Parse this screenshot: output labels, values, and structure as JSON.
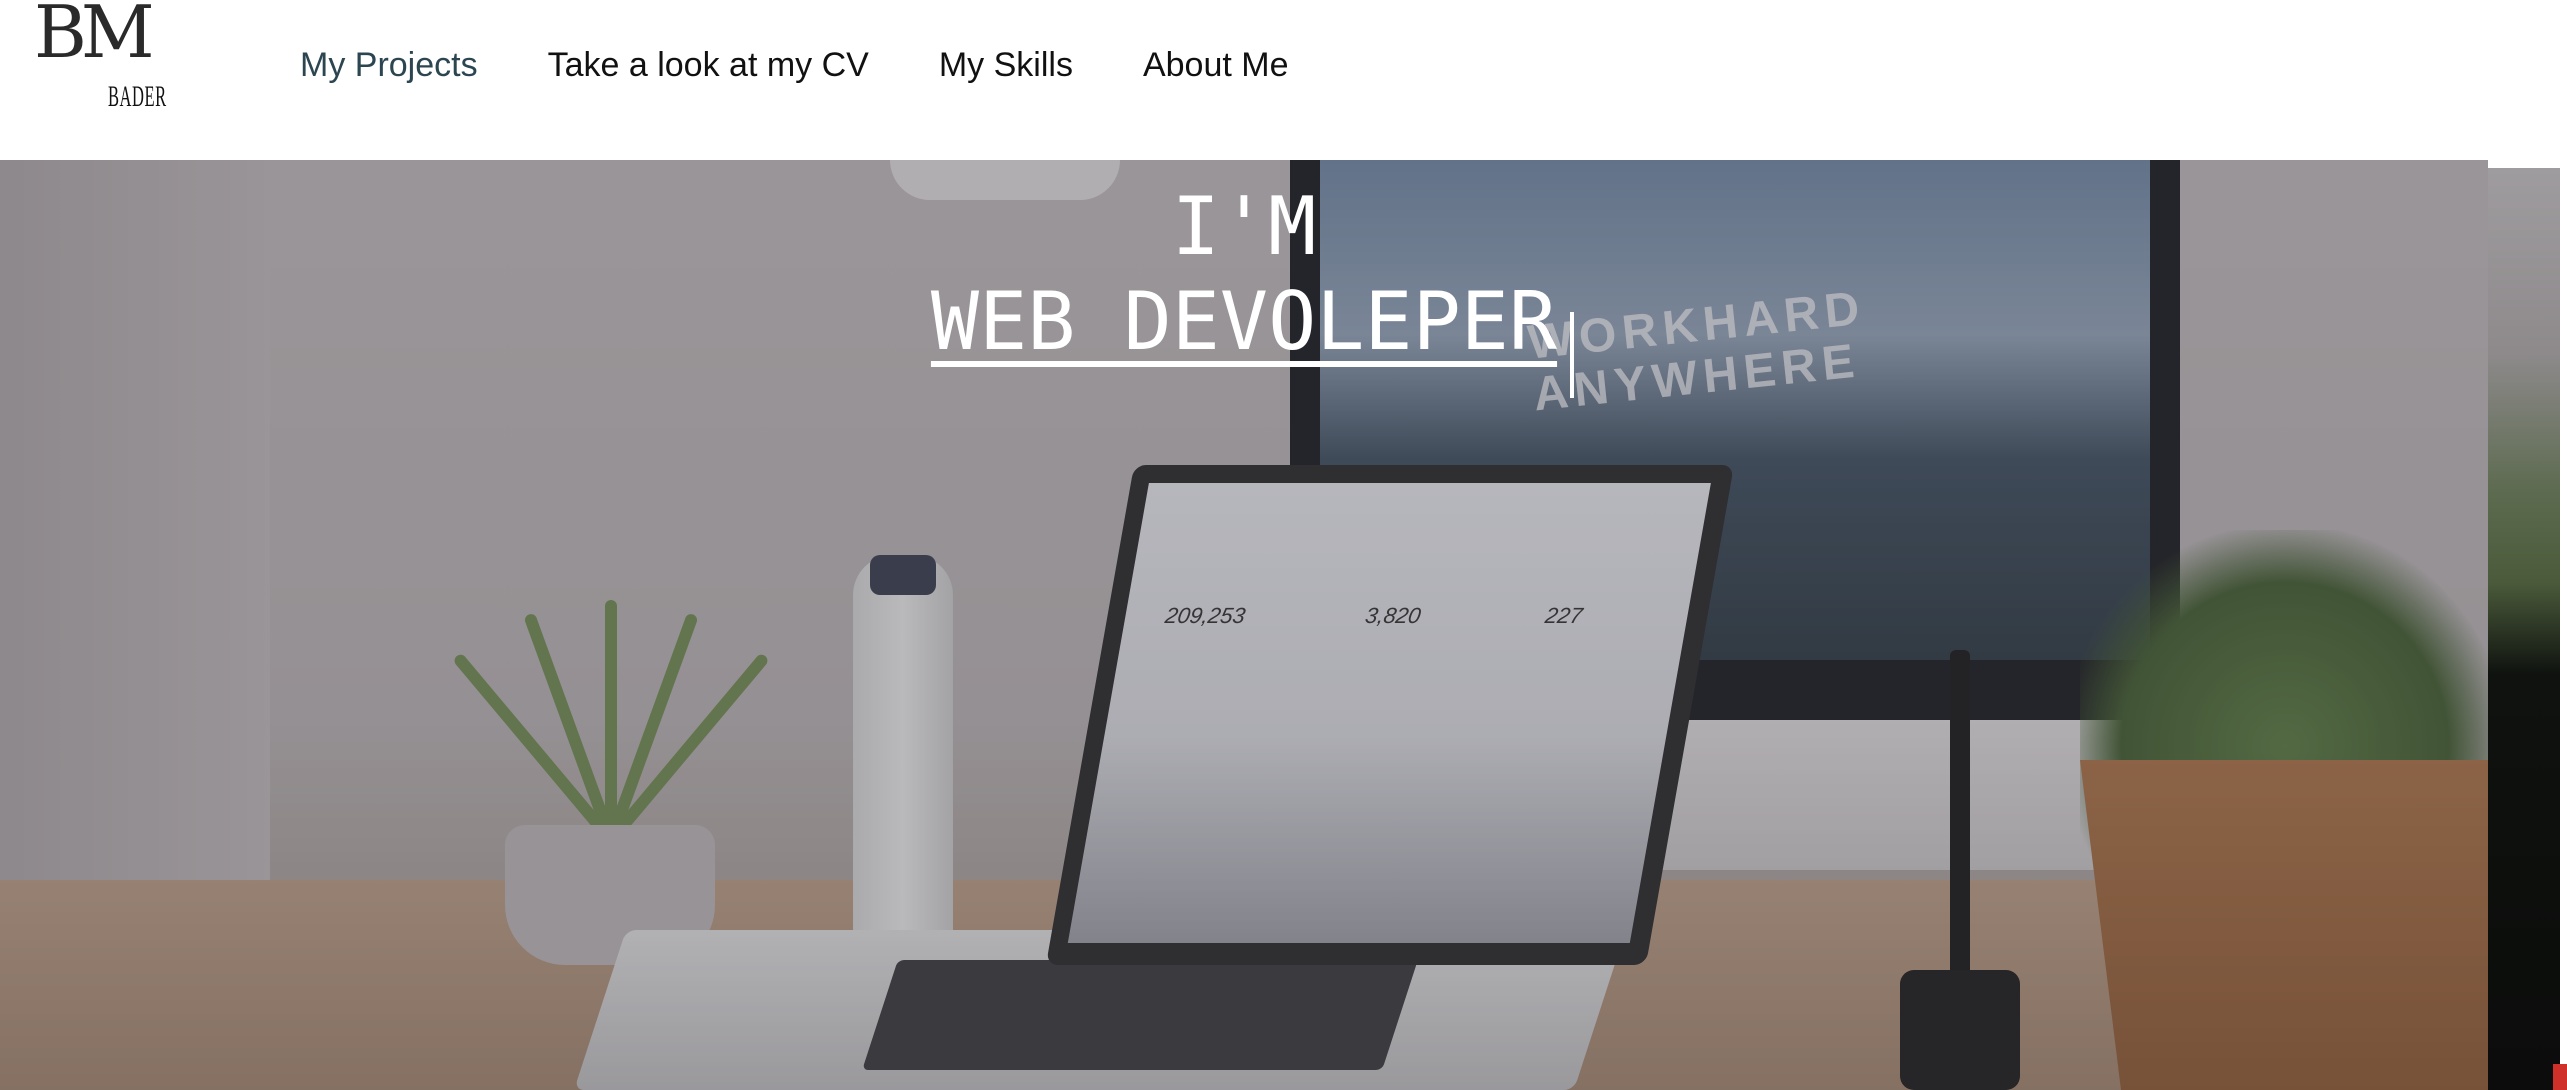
{
  "logo": {
    "monogram": "BM",
    "name": "BADER"
  },
  "nav": {
    "items": [
      {
        "label": "My Projects",
        "active": true
      },
      {
        "label": "Take a look at my CV",
        "active": false
      },
      {
        "label": "My Skills",
        "active": false
      },
      {
        "label": "About Me",
        "active": false
      }
    ],
    "active_color": "#2c4651",
    "text_color": "#111111"
  },
  "hero": {
    "line1": "I'M",
    "line2": "WEB DEVOLEPER",
    "text_color": "#ffffff",
    "background_photo": {
      "monitor_text_line1": "WORKHARD",
      "monitor_text_line2": "ANYWHERE",
      "laptop_stats": [
        "209,253",
        "3,820",
        "227"
      ]
    }
  }
}
